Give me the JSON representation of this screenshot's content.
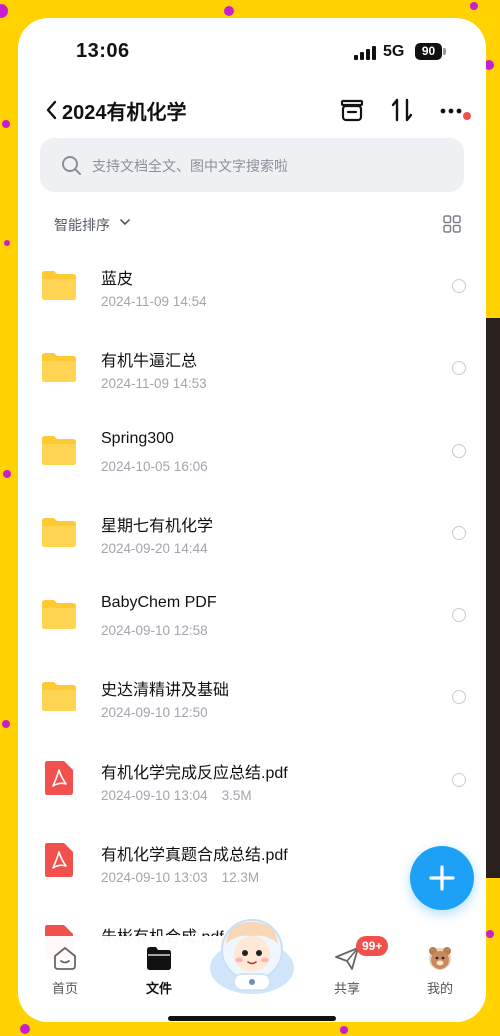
{
  "status": {
    "time": "13:06",
    "network": "5G",
    "battery": "90"
  },
  "nav": {
    "title": "2024有机化学"
  },
  "search": {
    "placeholder": "支持文档全文、图中文字搜索啦"
  },
  "sort": {
    "label": "智能排序"
  },
  "files": [
    {
      "name": "蓝皮",
      "date": "2024-11-09 14:54",
      "size": "",
      "type": "folder"
    },
    {
      "name": "有机牛逼汇总",
      "date": "2024-11-09 14:53",
      "size": "",
      "type": "folder"
    },
    {
      "name": "Spring300",
      "date": "2024-10-05 16:06",
      "size": "",
      "type": "folder"
    },
    {
      "name": "星期七有机化学",
      "date": "2024-09-20 14:44",
      "size": "",
      "type": "folder"
    },
    {
      "name": "BabyChem PDF",
      "date": "2024-09-10 12:58",
      "size": "",
      "type": "folder"
    },
    {
      "name": "史达清精讲及基础",
      "date": "2024-09-10 12:50",
      "size": "",
      "type": "folder"
    },
    {
      "name": "有机化学完成反应总结.pdf",
      "date": "2024-09-10 13:04",
      "size": "3.5M",
      "type": "pdf"
    },
    {
      "name": "有机化学真题合成总结.pdf",
      "date": "2024-09-10 13:03",
      "size": "12.3M",
      "type": "pdf"
    },
    {
      "name": "朱彬有机合成.pdf",
      "date": "",
      "size": "",
      "type": "pdf"
    }
  ],
  "tabs": [
    {
      "label": "首页",
      "icon": "home-icon"
    },
    {
      "label": "文件",
      "icon": "folder-icon"
    },
    {
      "label": "共享",
      "icon": "share-icon"
    },
    {
      "label": "我的",
      "icon": "profile-avatar-icon"
    }
  ],
  "badge": "99+",
  "colors": {
    "accent": "#1da1f6",
    "folder": "#ffc933",
    "pdf": "#f2504c",
    "badge": "#f2504c",
    "border": "#ffd200"
  }
}
